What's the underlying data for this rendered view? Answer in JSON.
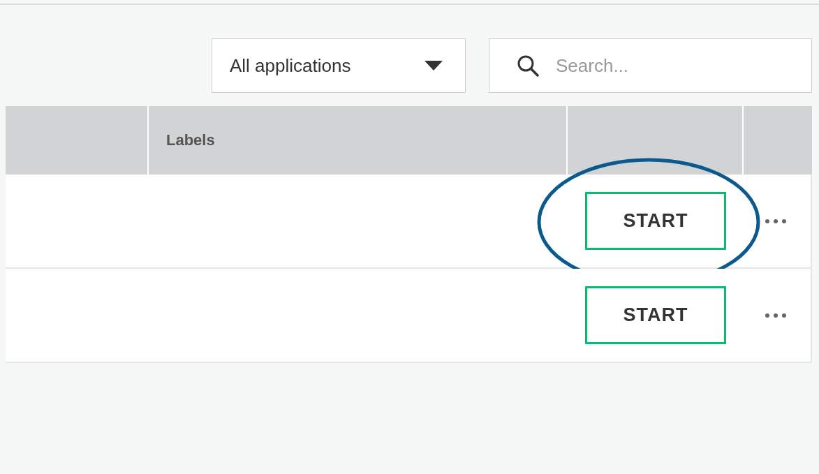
{
  "filter": {
    "value": "All applications"
  },
  "search": {
    "placeholder": "Search..."
  },
  "table": {
    "columns": [
      {},
      {
        "label": "Labels"
      },
      {},
      {}
    ],
    "rows": [
      {
        "action": "START",
        "highlighted": true
      },
      {
        "action": "START",
        "highlighted": false
      }
    ]
  }
}
